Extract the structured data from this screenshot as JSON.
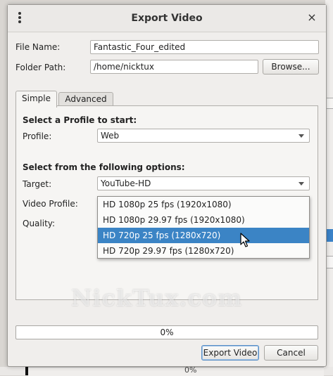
{
  "dialog": {
    "title": "Export Video",
    "close_glyph": "×"
  },
  "form": {
    "file_name_label": "File Name:",
    "file_name_value": "Fantastic_Four_edited",
    "folder_path_label": "Folder Path:",
    "folder_path_value": "/home/nicktux",
    "browse_label": "Browse..."
  },
  "tabs": [
    {
      "label": "Simple",
      "active": true
    },
    {
      "label": "Advanced",
      "active": false
    }
  ],
  "simple": {
    "profile_heading": "Select a Profile to start:",
    "profile_label": "Profile:",
    "profile_value": "Web",
    "options_heading": "Select from the following options:",
    "target_label": "Target:",
    "target_value": "YouTube-HD",
    "video_profile_label": "Video Profile:",
    "quality_label": "Quality:",
    "video_profile_options": [
      {
        "label": "HD 1080p 25 fps (1920x1080)",
        "selected": false
      },
      {
        "label": "HD 1080p 29.97 fps (1920x1080)",
        "selected": false
      },
      {
        "label": "HD 720p 25 fps (1280x720)",
        "selected": true
      },
      {
        "label": "HD 720p 29.97 fps (1280x720)",
        "selected": false
      }
    ]
  },
  "watermark": "NickTux.com",
  "progress": {
    "text": "0%",
    "value": 0
  },
  "buttons": {
    "export_label": "Export Video",
    "cancel_label": "Cancel"
  },
  "background": {
    "progress_text": "0%"
  },
  "colors": {
    "selection": "#3b84c5",
    "dialog_bg": "#f0eeec"
  }
}
